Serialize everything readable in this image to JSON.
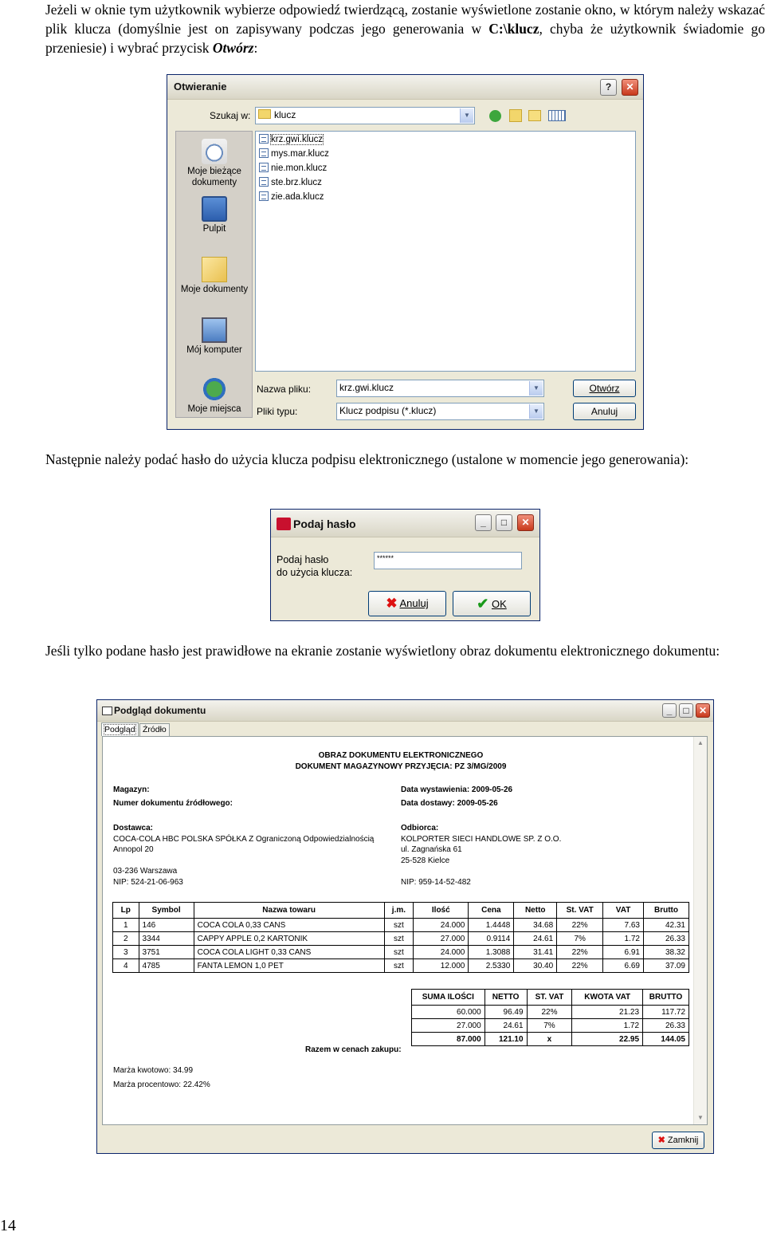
{
  "para1": {
    "before": "Jeżeli w oknie tym użytkownik wybierze odpowiedź twierdzącą, zostanie wyświetlone zostanie okno, w którym należy wskazać plik klucza (domyślnie jest on zapisywany podczas jego generowania w ",
    "bold": "C:\\klucz",
    "middle": ", chyba że użytkownik świadomie go przeniesie) i wybrać przycisk ",
    "italic": "Otwórz",
    "after": ":"
  },
  "open_dialog": {
    "title": "Otwieranie",
    "lookin_label": "Szukaj w:",
    "lookin_value": "klucz",
    "places": [
      "Moje bieżące dokumenty",
      "Pulpit",
      "Moje dokumenty",
      "Mój komputer",
      "Moje miejsca"
    ],
    "files": [
      "krz.gwi.klucz",
      "mys.mar.klucz",
      "nie.mon.klucz",
      "ste.brz.klucz",
      "zie.ada.klucz"
    ],
    "filename_label": "Nazwa pliku:",
    "filename_value": "krz.gwi.klucz",
    "filetype_label": "Pliki typu:",
    "filetype_value": "Klucz podpisu (*.klucz)",
    "open_button": "Otwórz",
    "cancel_button": "Anuluj",
    "help_button": "?",
    "close_button": "✕"
  },
  "para2": "Następnie należy podać hasło do użycia klucza podpisu elektronicznego (ustalone w momencie jego generowania):",
  "password_dialog": {
    "title": "Podaj hasło",
    "label_line1": "Podaj hasło",
    "label_line2": "do użycia klucza:",
    "password_mask": "******",
    "cancel_button": "Anuluj",
    "ok_button": "OK"
  },
  "para3": "Jeśli tylko podane hasło jest prawidłowe na ekranie zostanie wyświetlony obraz dokumentu elektronicznego dokumentu:",
  "preview": {
    "title": "Podgląd dokumentu",
    "tabs": [
      "Podgląd",
      "Źródło"
    ],
    "doc_title1": "OBRAZ DOKUMENTU ELEKTRONICZNEGO",
    "doc_title2": "DOKUMENT MAGAZYNOWY PRZYJĘCIA: PZ 3/MG/2009",
    "magazyn_label": "Magazyn:",
    "nr_label": "Numer dokumentu źródłowego:",
    "data_wyst": "Data wystawienia: 2009-05-26",
    "data_dost": "Data dostawy: 2009-05-26",
    "dostawca_label": "Dostawca:",
    "dostawca_name": "COCA-COLA HBC POLSKA SPÓŁKA Z Ograniczoną Odpowiedzialnością",
    "dostawca_addr1": "Annopol 20",
    "dostawca_addr2": "03-236 Warszawa",
    "dostawca_nip": "NIP: 524-21-06-963",
    "odbiorca_label": "Odbiorca:",
    "odbiorca_name": "KOLPORTER SIECI HANDLOWE SP. Z O.O.",
    "odbiorca_addr1": "ul. Zagnańska 61",
    "odbiorca_addr2": "25-528 Kielce",
    "odbiorca_nip": "NIP: 959-14-52-482",
    "items_headers": [
      "Lp",
      "Symbol",
      "Nazwa towaru",
      "j.m.",
      "Ilość",
      "Cena",
      "Netto",
      "St. VAT",
      "VAT",
      "Brutto"
    ],
    "items": [
      [
        "1",
        "146",
        "COCA COLA 0,33 CANS",
        "szt",
        "24.000",
        "1.4448",
        "34.68",
        "22%",
        "7.63",
        "42.31"
      ],
      [
        "2",
        "3344",
        "CAPPY APPLE 0,2 KARTONIK",
        "szt",
        "27.000",
        "0.9114",
        "24.61",
        "7%",
        "1.72",
        "26.33"
      ],
      [
        "3",
        "3751",
        "COCA COLA LIGHT 0,33 CANS",
        "szt",
        "24.000",
        "1.3088",
        "31.41",
        "22%",
        "6.91",
        "38.32"
      ],
      [
        "4",
        "4785",
        "FANTA LEMON 1,0 PET",
        "szt",
        "12.000",
        "2.5330",
        "30.40",
        "22%",
        "6.69",
        "37.09"
      ]
    ],
    "summary_headers": [
      "SUMA ILOŚCI",
      "NETTO",
      "ST. VAT",
      "KWOTA VAT",
      "BRUTTO"
    ],
    "summary_rows": [
      [
        "60.000",
        "96.49",
        "22%",
        "21.23",
        "117.72"
      ],
      [
        "27.000",
        "24.61",
        "7%",
        "1.72",
        "26.33"
      ]
    ],
    "total_label": "Razem w cenach zakupu:",
    "total_row": [
      "87.000",
      "121.10",
      "x",
      "22.95",
      "144.05"
    ],
    "marza_kwot": "Marża kwotowo: 34.99",
    "marza_proc": "Marża procentowo: 22.42%",
    "close_button": "Zamknij"
  },
  "page_number": "14"
}
